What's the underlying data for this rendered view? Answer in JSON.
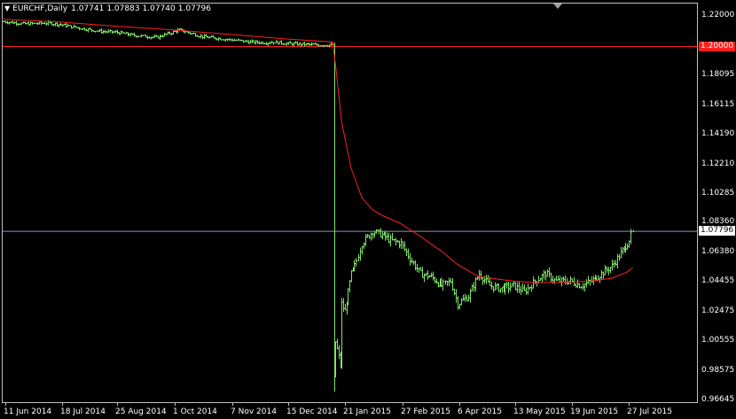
{
  "header": {
    "menu_icon": "triangle-down-icon",
    "symbol": "EURCHF,Daily",
    "open": "1.07741",
    "high": "1.07883",
    "low": "1.07740",
    "close": "1.07796"
  },
  "colors": {
    "background": "#000000",
    "bars": "#7fe36a",
    "moving_average": "#ff2020",
    "level_line": "#ff1e1e",
    "bid_line": "#8a9bb0",
    "frame": "#c0c0c0",
    "text": "#ffffff"
  },
  "price_axis": {
    "labels": [
      "1.22000",
      "1.20000",
      "1.18095",
      "1.16115",
      "1.14190",
      "1.12210",
      "1.10285",
      "1.08360",
      "1.07796",
      "1.06380",
      "1.04455",
      "1.02475",
      "1.00555",
      "0.98575",
      "0.96645"
    ],
    "level_label": "1.20000",
    "bid_label": "1.07796"
  },
  "time_axis": {
    "labels": [
      "11 Jun 2014",
      "18 Jul 2014",
      "25 Aug 2014",
      "1 Oct 2014",
      "7 Nov 2014",
      "15 Dec 2014",
      "21 Jan 2015",
      "27 Feb 2015",
      "6 Apr 2015",
      "13 May 2015",
      "19 Jun 2015",
      "27 Jul 2015"
    ]
  },
  "chart_data": {
    "type": "ohlc",
    "symbol": "EURCHF",
    "timeframe": "Daily",
    "ylim": [
      0.9645,
      1.229
    ],
    "grid": false,
    "horizontal_lines": [
      1.2,
      1.07796
    ],
    "series": [
      {
        "kind": "price-bars",
        "x": [
          "2014-06-11",
          "2014-06-25",
          "2014-07-10",
          "2014-07-18",
          "2014-08-01",
          "2014-08-15",
          "2014-08-25",
          "2014-09-05",
          "2014-09-20",
          "2014-10-01",
          "2014-10-05",
          "2014-10-20",
          "2014-11-07",
          "2014-11-20",
          "2014-12-01",
          "2014-12-05",
          "2014-12-15",
          "2015-01-05",
          "2015-01-14",
          "2015-01-15",
          "2015-01-16",
          "2015-01-19",
          "2015-01-20",
          "2015-01-22",
          "2015-01-26",
          "2015-01-28",
          "2015-02-02",
          "2015-02-09",
          "2015-02-16",
          "2015-02-20",
          "2015-02-27",
          "2015-03-05",
          "2015-03-12",
          "2015-03-19",
          "2015-03-26",
          "2015-04-01",
          "2015-04-06",
          "2015-04-13",
          "2015-04-20",
          "2015-04-27",
          "2015-05-04",
          "2015-05-13",
          "2015-05-20",
          "2015-05-27",
          "2015-06-03",
          "2015-06-10",
          "2015-06-19",
          "2015-06-26",
          "2015-07-03",
          "2015-07-10",
          "2015-07-17",
          "2015-07-24",
          "2015-07-27",
          "2015-07-31"
        ],
        "y": [
          1.2165,
          1.215,
          1.2155,
          1.2145,
          1.212,
          1.21,
          1.2095,
          1.2075,
          1.206,
          1.2095,
          1.211,
          1.2065,
          1.2045,
          1.203,
          1.2025,
          1.203,
          1.202,
          1.201,
          1.201,
          0.98,
          1.005,
          0.99,
          1.03,
          1.025,
          1.05,
          1.055,
          1.07,
          1.078,
          1.075,
          1.072,
          1.07,
          1.06,
          1.05,
          1.048,
          1.042,
          1.045,
          1.03,
          1.035,
          1.05,
          1.042,
          1.04,
          1.042,
          1.038,
          1.045,
          1.05,
          1.045,
          1.045,
          1.042,
          1.045,
          1.05,
          1.055,
          1.065,
          1.07,
          1.078
        ]
      },
      {
        "kind": "moving-average",
        "x": [
          "2014-06-11",
          "2014-07-18",
          "2014-08-25",
          "2014-10-01",
          "2014-11-07",
          "2014-12-15",
          "2015-01-14",
          "2015-01-16",
          "2015-01-20",
          "2015-01-26",
          "2015-02-02",
          "2015-02-09",
          "2015-02-16",
          "2015-02-27",
          "2015-03-10",
          "2015-03-26",
          "2015-04-06",
          "2015-04-20",
          "2015-05-13",
          "2015-05-27",
          "2015-06-19",
          "2015-07-03",
          "2015-07-17",
          "2015-07-27",
          "2015-07-31"
        ],
        "y": [
          1.218,
          1.2162,
          1.2135,
          1.211,
          1.208,
          1.205,
          1.203,
          1.188,
          1.15,
          1.12,
          1.1,
          1.092,
          1.088,
          1.083,
          1.076,
          1.065,
          1.056,
          1.048,
          1.045,
          1.044,
          1.0445,
          1.045,
          1.047,
          1.051,
          1.054
        ]
      }
    ]
  }
}
